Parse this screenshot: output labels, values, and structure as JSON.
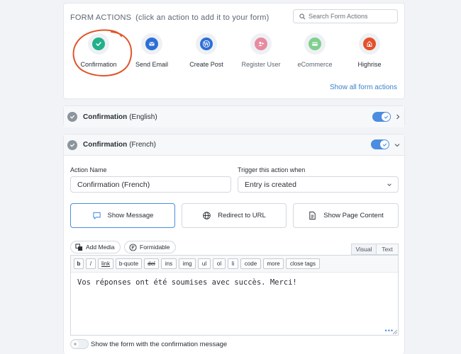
{
  "form_actions": {
    "title": "FORM ACTIONS",
    "hint": "(click an action to add it to your form)",
    "search_placeholder": "Search Form Actions",
    "show_all": "Show all form actions",
    "items": [
      {
        "label": "Confirmation",
        "icon": "checkmark-icon",
        "color": "#21b08b"
      },
      {
        "label": "Send Email",
        "icon": "email-icon",
        "color": "#2e6fd6"
      },
      {
        "label": "Create Post",
        "icon": "wordpress-icon",
        "color": "#2e6fd6"
      },
      {
        "label": "Register User",
        "icon": "add-user-icon",
        "color": "#e88aa0"
      },
      {
        "label": "eCommerce",
        "icon": "credit-card-icon",
        "color": "#7fcf8f"
      },
      {
        "label": "Highrise",
        "icon": "highrise-icon",
        "color": "#e4502a"
      }
    ],
    "annotation_color": "#e0552a"
  },
  "confirmation_en": {
    "title": "Confirmation",
    "lang": "(English)",
    "enabled": true
  },
  "confirmation_fr": {
    "title": "Confirmation",
    "lang": "(French)",
    "enabled": true,
    "action_name_label": "Action Name",
    "action_name_value": "Confirmation",
    "action_name_lang": "(French)",
    "trigger_label": "Trigger this action when",
    "trigger_value": "Entry is created",
    "types": [
      {
        "label": "Show Message",
        "active": true
      },
      {
        "label": "Redirect to URL",
        "active": false
      },
      {
        "label": "Show Page Content",
        "active": false
      }
    ],
    "add_media": "Add Media",
    "formidable": "Formidable",
    "tab_visual": "Visual",
    "tab_text": "Text",
    "toolbar": [
      "b",
      "/",
      "link",
      "b-quote",
      "del",
      "ins",
      "img",
      "ul",
      "ol",
      "li",
      "code",
      "more",
      "close tags"
    ],
    "message": "Vos réponses ont été soumises avec succès. Merci!",
    "dots": "•••",
    "show_form_label": "Show the form with the confirmation message"
  },
  "colors": {
    "accent": "#4b8de0",
    "link": "#3b82c9"
  }
}
